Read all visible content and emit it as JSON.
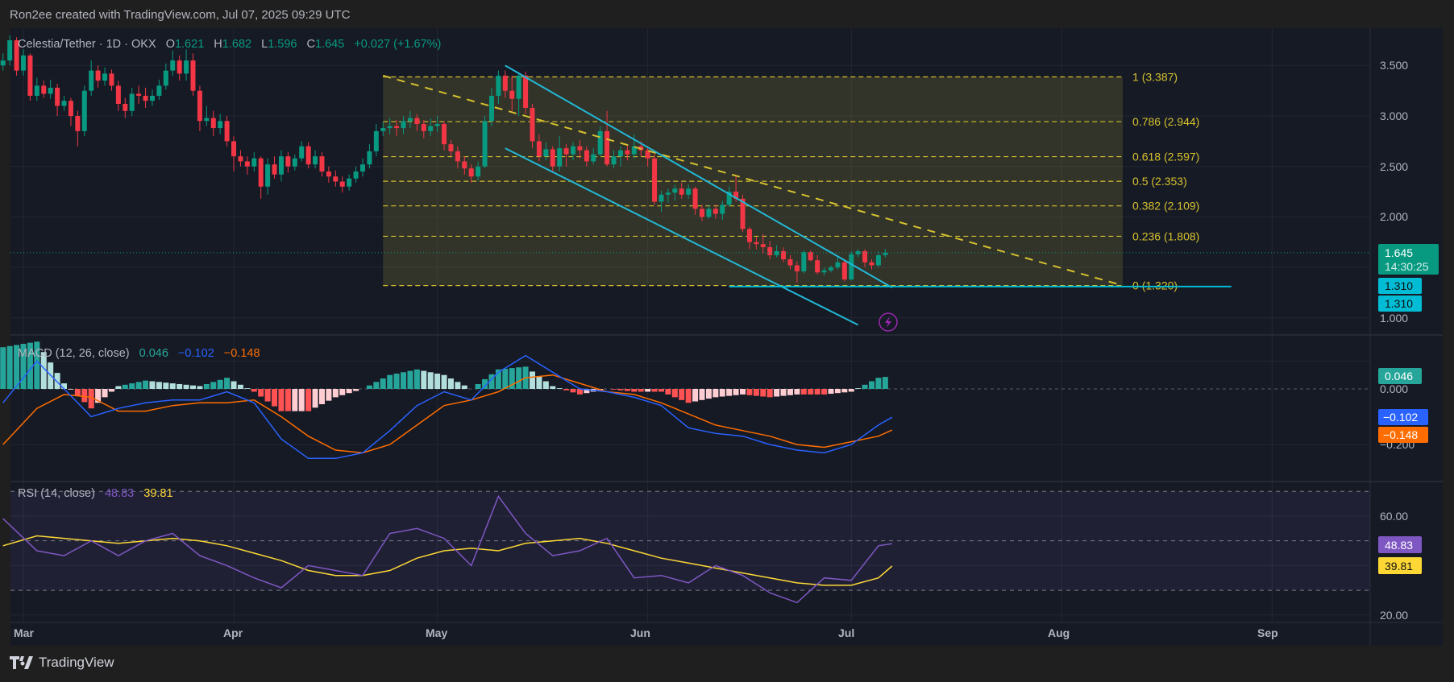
{
  "header": {
    "title": "Ron2ee created with TradingView.com, Jul 07, 2025 09:29 UTC"
  },
  "footer": {
    "brand": "TradingView",
    "logo_icon": "tradingview-logo-icon"
  },
  "legend": {
    "symbol": "Celestia/Tether · 1D · OKX",
    "o_label": "O",
    "o": "1.621",
    "h_label": "H",
    "h": "1.682",
    "l_label": "L",
    "l": "1.596",
    "c_label": "C",
    "c": "1.645",
    "change": "+0.027 (+1.67%)"
  },
  "price_axis": {
    "ticks": [
      "3.500",
      "3.000",
      "2.500",
      "2.000",
      "1.000"
    ],
    "last_price": "1.645",
    "countdown": "14:30:25",
    "level_labels": [
      "1.310",
      "1.310"
    ]
  },
  "macd": {
    "title": "MACD (12, 26, close)",
    "hist_value": "0.046",
    "macd_value": "−0.102",
    "signal_value": "−0.148",
    "ticks": [
      "0.000",
      "−0.200"
    ]
  },
  "rsi": {
    "title": "RSI (14, close)",
    "rsi_value": "48.83",
    "ma_value": "39.81",
    "ticks": [
      "60.00",
      "20.00"
    ]
  },
  "time_axis": {
    "labels": [
      "Mar",
      "Apr",
      "May",
      "Jun",
      "Jul",
      "Aug",
      "Sep"
    ]
  },
  "fib": {
    "levels": [
      {
        "ratio": 1,
        "price": 3.387,
        "label": "1 (3.387)"
      },
      {
        "ratio": 0.786,
        "price": 2.944,
        "label": "0.786 (2.944)"
      },
      {
        "ratio": 0.618,
        "price": 2.597,
        "label": "0.618 (2.597)"
      },
      {
        "ratio": 0.5,
        "price": 2.353,
        "label": "0.5 (2.353)"
      },
      {
        "ratio": 0.382,
        "price": 2.109,
        "label": "0.382 (2.109)"
      },
      {
        "ratio": 0.236,
        "price": 1.808,
        "label": "0.236 (1.808)"
      },
      {
        "ratio": 0,
        "price": 1.32,
        "label": "0 (1.320)"
      }
    ]
  },
  "colors": {
    "up": "#089981",
    "down": "#f23645",
    "bg": "#161a25",
    "grid": "#232734",
    "fib": "#d6c12f",
    "channel": "#22b8d6",
    "macd": "#2962ff",
    "signal": "#ff6d00",
    "hist_up_strong": "#26a69a",
    "hist_up_weak": "#b2dfdb",
    "hist_dn_strong": "#ff5252",
    "hist_dn_weak": "#ffcdd2",
    "rsi": "#7e57c2",
    "rsi_ma": "#fdd835",
    "level": "#00bcd4"
  },
  "chart_data": {
    "type": "candlestick",
    "symbol": "Celestia/Tether",
    "interval": "1D",
    "exchange": "OKX",
    "first_candle": "Feb 27",
    "last_candle": "Jul 7",
    "price_ylim": [
      0.83,
      3.87
    ],
    "candles_ohlc": [
      [
        3.5,
        3.62,
        3.45,
        3.55
      ],
      [
        3.55,
        3.8,
        3.5,
        3.75
      ],
      [
        3.75,
        3.78,
        3.4,
        3.45
      ],
      [
        3.45,
        3.66,
        3.4,
        3.6
      ],
      [
        3.6,
        3.62,
        3.15,
        3.2
      ],
      [
        3.2,
        3.38,
        3.15,
        3.3
      ],
      [
        3.3,
        3.35,
        3.18,
        3.22
      ],
      [
        3.22,
        3.36,
        3.17,
        3.28
      ],
      [
        3.28,
        3.32,
        3.0,
        3.1
      ],
      [
        3.1,
        3.2,
        3.05,
        3.15
      ],
      [
        3.15,
        3.18,
        2.9,
        3.0
      ],
      [
        3.0,
        3.05,
        2.7,
        2.85
      ],
      [
        2.85,
        3.3,
        2.8,
        3.25
      ],
      [
        3.25,
        3.55,
        3.2,
        3.45
      ],
      [
        3.45,
        3.5,
        3.28,
        3.35
      ],
      [
        3.35,
        3.48,
        3.3,
        3.42
      ],
      [
        3.42,
        3.46,
        3.25,
        3.3
      ],
      [
        3.3,
        3.35,
        3.05,
        3.12
      ],
      [
        3.12,
        3.18,
        2.98,
        3.05
      ],
      [
        3.05,
        3.28,
        3.0,
        3.22
      ],
      [
        3.22,
        3.3,
        3.12,
        3.2
      ],
      [
        3.2,
        3.28,
        3.08,
        3.15
      ],
      [
        3.15,
        3.26,
        3.1,
        3.2
      ],
      [
        3.2,
        3.36,
        3.16,
        3.3
      ],
      [
        3.3,
        3.52,
        3.26,
        3.45
      ],
      [
        3.45,
        3.65,
        3.4,
        3.55
      ],
      [
        3.55,
        3.6,
        3.35,
        3.42
      ],
      [
        3.42,
        3.66,
        3.35,
        3.55
      ],
      [
        3.55,
        3.62,
        3.2,
        3.25
      ],
      [
        3.25,
        3.3,
        2.85,
        2.95
      ],
      [
        2.95,
        3.1,
        2.9,
        2.98
      ],
      [
        2.98,
        3.05,
        2.8,
        2.88
      ],
      [
        2.88,
        3.02,
        2.82,
        2.95
      ],
      [
        2.95,
        3.0,
        2.7,
        2.75
      ],
      [
        2.75,
        2.8,
        2.45,
        2.6
      ],
      [
        2.6,
        2.66,
        2.5,
        2.55
      ],
      [
        2.55,
        2.6,
        2.42,
        2.5
      ],
      [
        2.5,
        2.64,
        2.45,
        2.58
      ],
      [
        2.58,
        2.6,
        2.18,
        2.3
      ],
      [
        2.3,
        2.58,
        2.22,
        2.52
      ],
      [
        2.52,
        2.6,
        2.38,
        2.42
      ],
      [
        2.42,
        2.66,
        2.35,
        2.6
      ],
      [
        2.6,
        2.64,
        2.44,
        2.5
      ],
      [
        2.5,
        2.62,
        2.46,
        2.58
      ],
      [
        2.58,
        2.75,
        2.55,
        2.7
      ],
      [
        2.7,
        2.74,
        2.48,
        2.52
      ],
      [
        2.52,
        2.66,
        2.48,
        2.6
      ],
      [
        2.6,
        2.64,
        2.4,
        2.45
      ],
      [
        2.45,
        2.5,
        2.34,
        2.4
      ],
      [
        2.4,
        2.46,
        2.3,
        2.35
      ],
      [
        2.35,
        2.4,
        2.24,
        2.3
      ],
      [
        2.3,
        2.42,
        2.26,
        2.38
      ],
      [
        2.38,
        2.5,
        2.34,
        2.45
      ],
      [
        2.45,
        2.58,
        2.4,
        2.52
      ],
      [
        2.52,
        2.72,
        2.48,
        2.65
      ],
      [
        2.65,
        2.92,
        2.6,
        2.85
      ],
      [
        2.85,
        2.94,
        2.8,
        2.88
      ],
      [
        2.88,
        2.98,
        2.82,
        2.9
      ],
      [
        2.9,
        2.96,
        2.8,
        2.88
      ],
      [
        2.88,
        3.0,
        2.82,
        2.95
      ],
      [
        2.95,
        3.05,
        2.88,
        2.98
      ],
      [
        2.98,
        3.02,
        2.85,
        2.92
      ],
      [
        2.92,
        2.96,
        2.78,
        2.85
      ],
      [
        2.85,
        2.98,
        2.8,
        2.9
      ],
      [
        2.9,
        3.0,
        2.84,
        2.92
      ],
      [
        2.92,
        2.95,
        2.66,
        2.72
      ],
      [
        2.72,
        2.76,
        2.6,
        2.65
      ],
      [
        2.65,
        2.7,
        2.48,
        2.55
      ],
      [
        2.55,
        2.6,
        2.42,
        2.48
      ],
      [
        2.48,
        2.52,
        2.34,
        2.4
      ],
      [
        2.4,
        2.55,
        2.36,
        2.5
      ],
      [
        2.5,
        3.0,
        2.48,
        2.95
      ],
      [
        2.95,
        3.28,
        2.9,
        3.2
      ],
      [
        3.2,
        3.45,
        3.12,
        3.4
      ],
      [
        3.4,
        3.45,
        3.18,
        3.25
      ],
      [
        3.25,
        3.4,
        3.05,
        3.17
      ],
      [
        3.17,
        3.42,
        3.0,
        3.4
      ],
      [
        3.4,
        3.44,
        3.02,
        3.08
      ],
      [
        3.08,
        3.12,
        2.68,
        2.75
      ],
      [
        2.75,
        2.82,
        2.55,
        2.6
      ],
      [
        2.6,
        2.74,
        2.56,
        2.67
      ],
      [
        2.67,
        2.7,
        2.44,
        2.5
      ],
      [
        2.5,
        2.8,
        2.45,
        2.68
      ],
      [
        2.68,
        2.72,
        2.5,
        2.62
      ],
      [
        2.62,
        2.74,
        2.56,
        2.7
      ],
      [
        2.7,
        2.76,
        2.58,
        2.66
      ],
      [
        2.66,
        2.7,
        2.5,
        2.55
      ],
      [
        2.55,
        2.68,
        2.52,
        2.62
      ],
      [
        2.62,
        2.9,
        2.6,
        2.85
      ],
      [
        2.85,
        3.05,
        2.5,
        2.52
      ],
      [
        2.52,
        2.66,
        2.48,
        2.6
      ],
      [
        2.6,
        2.7,
        2.5,
        2.66
      ],
      [
        2.66,
        2.72,
        2.56,
        2.62
      ],
      [
        2.62,
        2.82,
        2.58,
        2.7
      ],
      [
        2.7,
        2.75,
        2.6,
        2.66
      ],
      [
        2.66,
        2.7,
        2.5,
        2.58
      ],
      [
        2.58,
        2.62,
        2.12,
        2.15
      ],
      [
        2.15,
        2.26,
        2.05,
        2.22
      ],
      [
        2.22,
        2.28,
        2.14,
        2.24
      ],
      [
        2.24,
        2.32,
        2.16,
        2.28
      ],
      [
        2.28,
        2.34,
        2.18,
        2.22
      ],
      [
        2.22,
        2.32,
        2.18,
        2.28
      ],
      [
        2.28,
        2.3,
        2.02,
        2.08
      ],
      [
        2.08,
        2.12,
        1.96,
        2.0
      ],
      [
        2.0,
        2.12,
        1.98,
        2.08
      ],
      [
        2.08,
        2.12,
        1.98,
        2.03
      ],
      [
        2.03,
        2.16,
        1.97,
        2.12
      ],
      [
        2.12,
        2.3,
        2.1,
        2.25
      ],
      [
        2.25,
        2.4,
        2.15,
        2.18
      ],
      [
        2.18,
        2.22,
        1.85,
        1.88
      ],
      [
        1.88,
        1.9,
        1.68,
        1.75
      ],
      [
        1.75,
        1.8,
        1.68,
        1.73
      ],
      [
        1.73,
        1.83,
        1.64,
        1.7
      ],
      [
        1.7,
        1.76,
        1.58,
        1.62
      ],
      [
        1.62,
        1.72,
        1.6,
        1.66
      ],
      [
        1.66,
        1.7,
        1.55,
        1.58
      ],
      [
        1.58,
        1.62,
        1.48,
        1.52
      ],
      [
        1.52,
        1.56,
        1.35,
        1.46
      ],
      [
        1.46,
        1.67,
        1.44,
        1.65
      ],
      [
        1.65,
        1.67,
        1.56,
        1.57
      ],
      [
        1.57,
        1.62,
        1.43,
        1.45
      ],
      [
        1.45,
        1.5,
        1.42,
        1.47
      ],
      [
        1.47,
        1.52,
        1.45,
        1.5
      ],
      [
        1.5,
        1.6,
        1.48,
        1.55
      ],
      [
        1.55,
        1.57,
        1.36,
        1.38
      ],
      [
        1.38,
        1.66,
        1.37,
        1.63
      ],
      [
        1.63,
        1.68,
        1.6,
        1.66
      ],
      [
        1.66,
        1.68,
        1.5,
        1.55
      ],
      [
        1.55,
        1.58,
        1.48,
        1.52
      ],
      [
        1.52,
        1.66,
        1.5,
        1.62
      ],
      [
        1.621,
        1.682,
        1.596,
        1.645
      ]
    ],
    "last_price": 1.645,
    "horizontal_level": 1.31,
    "indicator_sample_dates": [
      "Feb 27",
      "Mar 3",
      "Mar 7",
      "Mar 11",
      "Mar 15",
      "Mar 19",
      "Mar 23",
      "Mar 27",
      "Mar 31",
      "Apr 4",
      "Apr 8",
      "Apr 12",
      "Apr 16",
      "Apr 20",
      "Apr 24",
      "Apr 28",
      "May 2",
      "May 6",
      "May 10",
      "May 14",
      "May 18",
      "May 22",
      "May 26",
      "May 30",
      "Jun 3",
      "Jun 7",
      "Jun 11",
      "Jun 15",
      "Jun 19",
      "Jun 23",
      "Jun 27",
      "Jul 1",
      "Jul 5",
      "Jul 7"
    ],
    "macd_ylim": [
      -0.333,
      0.194
    ],
    "macd_line": [
      -0.05,
      0.1,
      0.0,
      -0.1,
      -0.07,
      -0.05,
      -0.04,
      -0.04,
      -0.01,
      -0.05,
      -0.18,
      -0.25,
      -0.25,
      -0.23,
      -0.15,
      -0.06,
      -0.01,
      -0.04,
      0.06,
      0.12,
      0.06,
      0.0,
      -0.01,
      -0.03,
      -0.06,
      -0.14,
      -0.16,
      -0.17,
      -0.2,
      -0.22,
      -0.23,
      -0.2,
      -0.13,
      -0.102
    ],
    "signal_line": [
      -0.2,
      -0.07,
      -0.02,
      -0.03,
      -0.08,
      -0.08,
      -0.06,
      -0.05,
      -0.05,
      -0.04,
      -0.1,
      -0.17,
      -0.22,
      -0.23,
      -0.2,
      -0.13,
      -0.06,
      -0.04,
      -0.01,
      0.04,
      0.05,
      0.02,
      -0.01,
      -0.02,
      -0.05,
      -0.09,
      -0.13,
      -0.15,
      -0.17,
      -0.2,
      -0.21,
      -0.19,
      -0.17,
      -0.148
    ],
    "rsi_ylim": [
      17,
      74
    ],
    "rsi_bands": [
      30,
      50,
      70
    ],
    "rsi_line": [
      59,
      46,
      44,
      50,
      44,
      50,
      53,
      44,
      40,
      35,
      31,
      40,
      38,
      36,
      53,
      55,
      51,
      40,
      68,
      53,
      44,
      46,
      51,
      35,
      36,
      33,
      40,
      36,
      29,
      25,
      35,
      34,
      48,
      48.83
    ],
    "rsi_ma": [
      48,
      52,
      51,
      50,
      49,
      50,
      51,
      50,
      48,
      45,
      42,
      38,
      36,
      36,
      38,
      43,
      46,
      47,
      46,
      49,
      50,
      51,
      49,
      46,
      43,
      41,
      39,
      37,
      35,
      33,
      32,
      32,
      35,
      39.81
    ],
    "drawings": {
      "fib_from": "Apr 23",
      "fib_to": "Aug 10",
      "dashed_trendline": [
        {
          "date": "Apr 23",
          "price": 3.4
        },
        {
          "date": "Aug 10",
          "price": 1.32
        }
      ],
      "channel_upper": [
        {
          "date": "May 11",
          "price": 3.5
        },
        {
          "date": "Jul 7",
          "price": 1.3
        }
      ],
      "channel_lower": [
        {
          "date": "May 11",
          "price": 2.68
        },
        {
          "date": "Jul 2",
          "price": 0.93
        }
      ],
      "level_from": "Jun 13",
      "level_to": "Aug 26"
    }
  }
}
